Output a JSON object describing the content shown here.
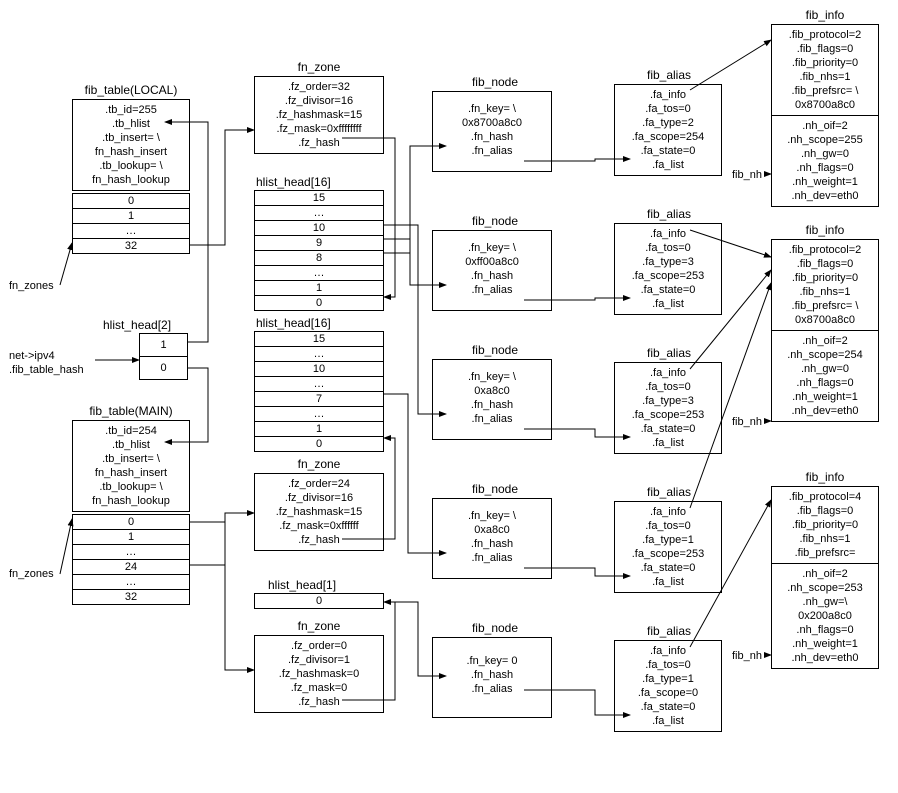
{
  "fib_table_local": {
    "title": "fib_table(LOCAL)",
    "lines": [
      ".tb_id=255",
      ".tb_hlist",
      ".tb_insert= \\",
      "fn_hash_insert",
      ".tb_lookup= \\",
      "fn_hash_lookup"
    ]
  },
  "fib_table_main": {
    "title": "fib_table(MAIN)",
    "lines": [
      ".tb_id=254",
      ".tb_hlist",
      ".tb_insert= \\",
      "fn_hash_insert",
      ".tb_lookup= \\",
      "fn_hash_lookup"
    ]
  },
  "fn_zones_local": [
    "0",
    "1",
    "…",
    "32"
  ],
  "fn_zones_main": [
    "0",
    "1",
    "…",
    "24",
    "…",
    "32"
  ],
  "fn_zones_label": "fn_zones",
  "hlist_head2": {
    "title": "hlist_head[2]",
    "rows": [
      "1",
      "0"
    ]
  },
  "net_ipv4_label1": "net->ipv4",
  "net_ipv4_label2": ".fib_table_hash",
  "fn_zone1": {
    "title": "fn_zone",
    "lines": [
      ".fz_order=32",
      ".fz_divisor=16",
      ".fz_hashmask=15",
      ".fz_mask=0xffffffff",
      ".fz_hash"
    ]
  },
  "fn_zone2": {
    "title": "fn_zone",
    "lines": [
      ".fz_order=24",
      ".fz_divisor=16",
      ".fz_hashmask=15",
      ".fz_mask=0xffffff",
      ".fz_hash"
    ]
  },
  "fn_zone3": {
    "title": "fn_zone",
    "lines": [
      ".fz_order=0",
      ".fz_divisor=1",
      ".fz_hashmask=0",
      ".fz_mask=0",
      ".fz_hash"
    ]
  },
  "hlist_head16a": {
    "title": "hlist_head[16]",
    "rows": [
      "15",
      "…",
      "10",
      "9",
      "8",
      "…",
      "1",
      "0"
    ]
  },
  "hlist_head16b": {
    "title": "hlist_head[16]",
    "rows": [
      "15",
      "…",
      "10",
      "…",
      "7",
      "…",
      "1",
      "0"
    ]
  },
  "hlist_head1": {
    "title": "hlist_head[1]",
    "rows": [
      "0"
    ]
  },
  "fib_node1": {
    "title": "fib_node",
    "lines": [
      ".fn_key= \\",
      "0x8700a8c0",
      ".fn_hash",
      ".fn_alias"
    ]
  },
  "fib_node2": {
    "title": "fib_node",
    "lines": [
      ".fn_key= \\",
      "0xff00a8c0",
      ".fn_hash",
      ".fn_alias"
    ]
  },
  "fib_node3": {
    "title": "fib_node",
    "lines": [
      ".fn_key= \\",
      "0xa8c0",
      ".fn_hash",
      ".fn_alias"
    ]
  },
  "fib_node4": {
    "title": "fib_node",
    "lines": [
      ".fn_key= \\",
      "0xa8c0",
      ".fn_hash",
      ".fn_alias"
    ]
  },
  "fib_node5": {
    "title": "fib_node",
    "lines": [
      ".fn_key= 0",
      ".fn_hash",
      ".fn_alias"
    ]
  },
  "fib_alias1": {
    "title": "fib_alias",
    "lines": [
      ".fa_info",
      ".fa_tos=0",
      ".fa_type=2",
      ".fa_scope=254",
      ".fa_state=0",
      ".fa_list"
    ]
  },
  "fib_alias2": {
    "title": "fib_alias",
    "lines": [
      ".fa_info",
      ".fa_tos=0",
      ".fa_type=3",
      ".fa_scope=253",
      ".fa_state=0",
      ".fa_list"
    ]
  },
  "fib_alias3": {
    "title": "fib_alias",
    "lines": [
      ".fa_info",
      ".fa_tos=0",
      ".fa_type=3",
      ".fa_scope=253",
      ".fa_state=0",
      ".fa_list"
    ]
  },
  "fib_alias4": {
    "title": "fib_alias",
    "lines": [
      ".fa_info",
      ".fa_tos=0",
      ".fa_type=1",
      ".fa_scope=253",
      ".fa_state=0",
      ".fa_list"
    ]
  },
  "fib_alias5": {
    "title": "fib_alias",
    "lines": [
      ".fa_info",
      ".fa_tos=0",
      ".fa_type=1",
      ".fa_scope=0",
      ".fa_state=0",
      ".fa_list"
    ]
  },
  "fib_info1": {
    "title": "fib_info",
    "lines": [
      ".fib_protocol=2",
      ".fib_flags=0",
      ".fib_priority=0",
      ".fib_nhs=1",
      ".fib_prefsrc= \\",
      "0x8700a8c0"
    ],
    "nh_lines": [
      ".nh_oif=2",
      ".nh_scope=255",
      ".nh_gw=0",
      ".nh_flags=0",
      ".nh_weight=1",
      ".nh_dev=eth0"
    ],
    "nh_label": "fib_nh"
  },
  "fib_info2": {
    "title": "fib_info",
    "lines": [
      ".fib_protocol=2",
      ".fib_flags=0",
      ".fib_priority=0",
      ".fib_nhs=1",
      ".fib_prefsrc= \\",
      "0x8700a8c0"
    ],
    "nh_lines": [
      ".nh_oif=2",
      ".nh_scope=254",
      ".nh_gw=0",
      ".nh_flags=0",
      ".nh_weight=1",
      ".nh_dev=eth0"
    ],
    "nh_label": "fib_nh"
  },
  "fib_info3": {
    "title": "fib_info",
    "lines": [
      ".fib_protocol=4",
      ".fib_flags=0",
      ".fib_priority=0",
      ".fib_nhs=1",
      ".fib_prefsrc="
    ],
    "nh_lines": [
      ".nh_oif=2",
      ".nh_scope=253",
      ".nh_gw=\\",
      "0x200a8c0",
      ".nh_flags=0",
      ".nh_weight=1",
      ".nh_dev=eth0"
    ],
    "nh_label": "fib_nh"
  }
}
